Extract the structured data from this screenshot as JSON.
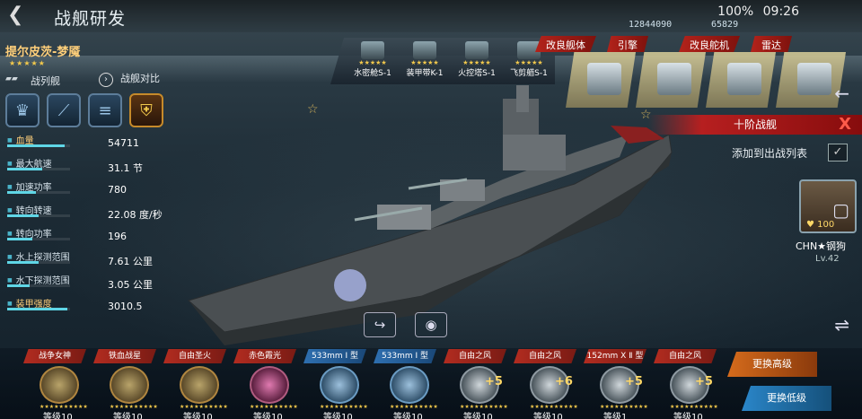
{
  "header": {
    "title": "战舰研发",
    "back_icon": "back-arrow-icon",
    "status_time": "09:26",
    "status_battery": "100%",
    "resource_1": "12844090",
    "resource_2": "65829"
  },
  "ship": {
    "name": "提尔皮茨-梦魇",
    "stars": "★★★★★",
    "class": "战列舰",
    "compare_label": "战舰对比",
    "stats": [
      {
        "label": "血量",
        "value": "54711",
        "fill": 0.92,
        "highlight": true
      },
      {
        "label": "最大航速",
        "value": "31.1 节",
        "fill": 0.55
      },
      {
        "label": "加速功率",
        "value": "780",
        "fill": 0.45
      },
      {
        "label": "转向转速",
        "value": "22.08 度/秒",
        "fill": 0.5
      },
      {
        "label": "转向功率",
        "value": "196",
        "fill": 0.4
      },
      {
        "label": "水上探测范围",
        "value": "7.61 公里",
        "fill": 0.5
      },
      {
        "label": "水下探测范围",
        "value": "3.05 公里",
        "fill": 0.35
      },
      {
        "label": "装甲强度",
        "value": "3010.5",
        "fill": 0.95,
        "highlight": true
      }
    ]
  },
  "modules": [
    {
      "name": "水密舱S-1",
      "stars": "★★★★★"
    },
    {
      "name": "装甲带K-1",
      "stars": "★★★★★"
    },
    {
      "name": "火控塔S-1",
      "stars": "★★★★★"
    },
    {
      "name": "飞剪艏S-1",
      "stars": "★★★★★"
    }
  ],
  "upgrades": {
    "tabs": [
      "改良舰体",
      "引擎",
      "改良舵机",
      "雷达"
    ]
  },
  "tier_label": "十阶战舰",
  "tier_close": "X",
  "add_fleet_label": "添加到出战列表",
  "add_fleet_check": "✓",
  "commander": {
    "level_badge": "100",
    "name": "CHN★钢狗",
    "lv": "Lv.42"
  },
  "weapons": [
    {
      "tag": "战争女神",
      "level": "等级10",
      "style": "red",
      "color": "gold"
    },
    {
      "tag": "铁血战星",
      "level": "等级10",
      "style": "red",
      "color": "gold"
    },
    {
      "tag": "自由圣火",
      "level": "等级10",
      "style": "red",
      "color": "gold"
    },
    {
      "tag": "赤色霞光",
      "level": "等级10",
      "style": "red",
      "color": "pink"
    },
    {
      "tag": "533mm Ⅰ 型",
      "level": "等级10",
      "style": "blue",
      "color": "blue"
    },
    {
      "tag": "533mm Ⅰ 型",
      "level": "等级10",
      "style": "blue",
      "color": "blue"
    },
    {
      "tag": "自由之风",
      "level": "等级10",
      "style": "red",
      "color": "grey",
      "plus": "+5"
    },
    {
      "tag": "自由之风",
      "level": "等级10",
      "style": "red",
      "color": "grey",
      "plus": "+6"
    },
    {
      "tag": "152mm X Ⅱ 型",
      "level": "等级1",
      "style": "red",
      "color": "grey",
      "plus": "+5"
    },
    {
      "tag": "自由之风",
      "level": "等级10",
      "style": "red",
      "color": "grey",
      "plus": "+5"
    }
  ],
  "swap": {
    "high": "更换高级",
    "low": "更换低级"
  }
}
